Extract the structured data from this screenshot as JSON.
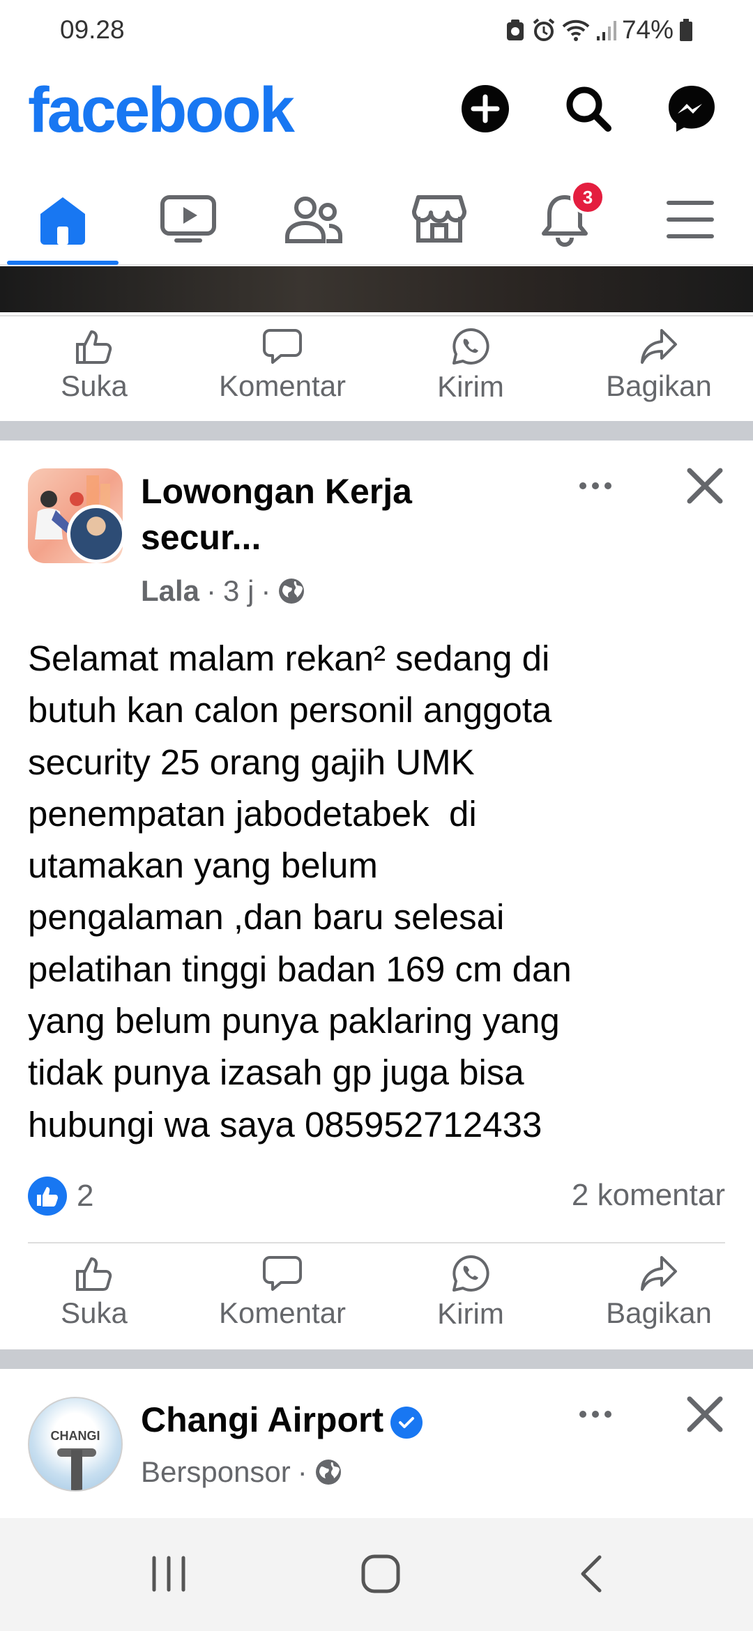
{
  "status_bar": {
    "time": "09.28",
    "battery": "74%"
  },
  "header": {
    "logo": "facebook",
    "brand_color": "#1877f2"
  },
  "nav": {
    "items": [
      "home-icon",
      "video-icon",
      "friends-icon",
      "marketplace-icon",
      "notifications-icon",
      "menu-icon"
    ],
    "active": "home",
    "notification_count": "3"
  },
  "actions": {
    "like": "Suka",
    "comment": "Komentar",
    "send": "Kirim",
    "share": "Bagikan"
  },
  "post1": {
    "title": "Lowongan Kerja secur...",
    "title_line1": "Lowongan Kerja",
    "title_line2": "secur...",
    "author": "Lala",
    "time": "3 j",
    "body": "Selamat malam rekan² sedang di\nbutuh kan calon personil anggota\nsecurity 25 orang gajih UMK\npenempatan jabodetabek  di\nutamakan yang belum\npengalaman ,dan baru selesai\npelatihan tinggi badan 169 cm dan\nyang belum punya paklaring yang\ntidak punya izasah gp juga bisa\nhubungi wa saya 085952712433",
    "reaction_count": "2",
    "comment_count": "2 komentar"
  },
  "post2": {
    "title": "Changi Airport",
    "meta": "Bersponsor",
    "avatar_text": "CHANGI"
  }
}
